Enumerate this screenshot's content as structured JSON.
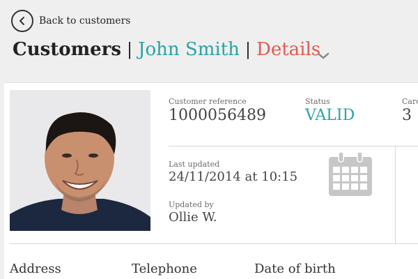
{
  "header": {
    "back_label": "Back to customers",
    "breadcrumb": {
      "root": "Customers",
      "separator": "|",
      "customer": "John Smith",
      "current": "Details"
    }
  },
  "customer": {
    "reference_label": "Customer reference",
    "reference_value": "1000056489",
    "status_label": "Status",
    "status_value": "VALID",
    "card_label": "Card",
    "card_value": "3",
    "last_updated_label": "Last updated",
    "last_updated_value": "24/11/2014 at 10:15",
    "updated_by_label": "Updated by",
    "updated_by_value": "Ollie W."
  },
  "sections": {
    "address": "Address",
    "telephone": "Telephone",
    "dob": "Date of birth"
  },
  "icons": {
    "back": "chevron-left-icon",
    "dropdown": "chevron-down-icon",
    "calendar": "calendar-icon"
  },
  "colors": {
    "accent_teal": "#2aa3a3",
    "accent_red": "#e05a4e",
    "background": "#efefef"
  }
}
